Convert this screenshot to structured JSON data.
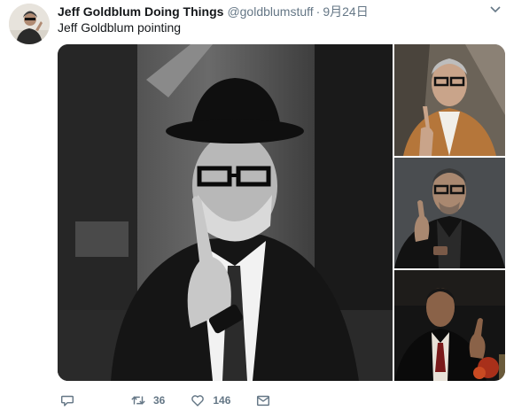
{
  "tweet": {
    "author_name": "Jeff Goldblum Doing Things",
    "handle": "@goldblumstuff",
    "separator": "·",
    "timestamp": "9月24日",
    "text": "Jeff Goldblum pointing",
    "avatar_icon": "avatar-photo"
  },
  "media": {
    "photos": [
      {
        "name": "photo-main",
        "icon": "man-in-hat-pointing"
      },
      {
        "name": "photo-2",
        "icon": "man-in-tan-jacket-pointing"
      },
      {
        "name": "photo-3",
        "icon": "man-in-leather-jacket-pointing"
      },
      {
        "name": "photo-4",
        "icon": "man-in-suit-pointing"
      }
    ]
  },
  "actions": {
    "reply": {
      "icon": "reply-icon"
    },
    "retweet": {
      "icon": "retweet-icon",
      "count": "36"
    },
    "like": {
      "icon": "heart-icon",
      "count": "146"
    },
    "message": {
      "icon": "envelope-icon"
    }
  },
  "colors": {
    "text_primary": "#14171a",
    "text_secondary": "#657786"
  }
}
